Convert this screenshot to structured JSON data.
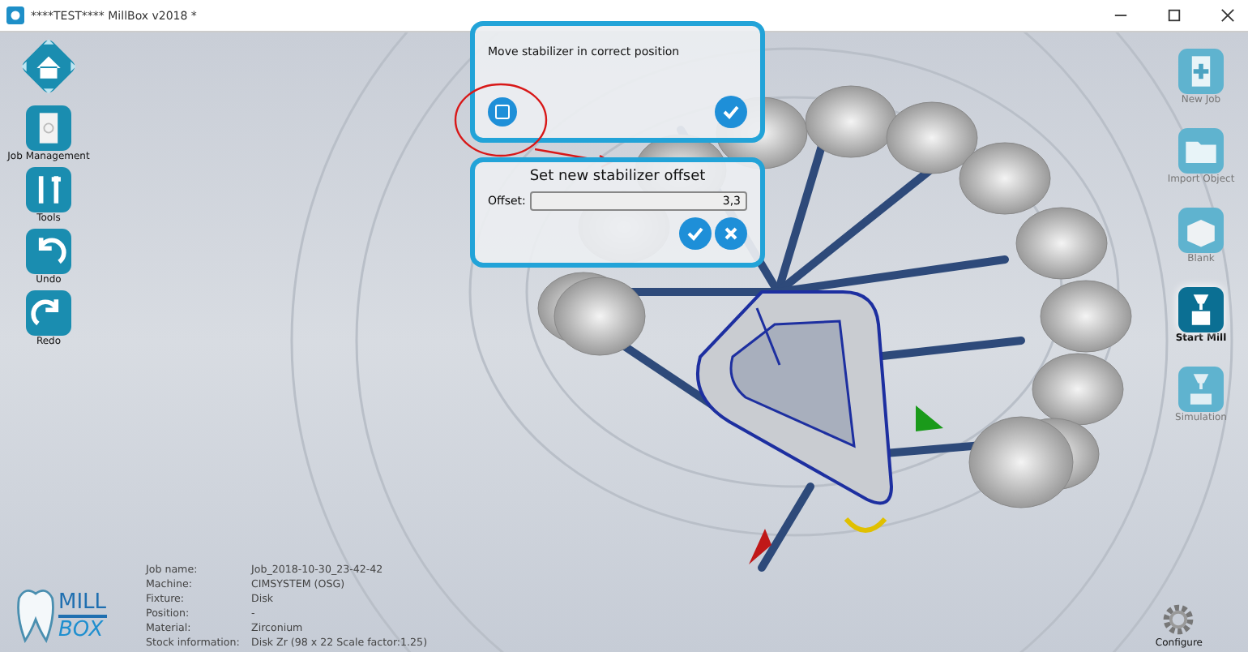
{
  "window": {
    "title": "****TEST**** MillBox v2018 *"
  },
  "left_toolbar": [
    {
      "label": "Job Management"
    },
    {
      "label": "Tools"
    },
    {
      "label": "Undo"
    },
    {
      "label": "Redo"
    }
  ],
  "right_toolbar": [
    {
      "label": "New Job",
      "selected": false
    },
    {
      "label": "Import Object",
      "selected": false
    },
    {
      "label": "Blank",
      "selected": false
    },
    {
      "label": "Start Mill",
      "selected": true
    },
    {
      "label": "Simulation",
      "selected": false
    }
  ],
  "move_dialog": {
    "message": "Move stabilizer in correct position"
  },
  "offset_dialog": {
    "title": "Set new stabilizer offset",
    "offset_label": "Offset:",
    "offset_value": "3,3"
  },
  "job_info": [
    {
      "label": "Job name:",
      "value": "Job_2018-10-30_23-42-42"
    },
    {
      "label": "Machine:",
      "value": "CIMSYSTEM (OSG)"
    },
    {
      "label": "Fixture:",
      "value": "Disk"
    },
    {
      "label": "Position:",
      "value": "-"
    },
    {
      "label": "Material:",
      "value": "Zirconium"
    },
    {
      "label": "Stock information:",
      "value": "Disk Zr (98 x 22 Scale factor:1.25)"
    }
  ],
  "logo": {
    "line_1": "MILL",
    "line_2": "BOX"
  },
  "configure": {
    "label": "Configure"
  }
}
